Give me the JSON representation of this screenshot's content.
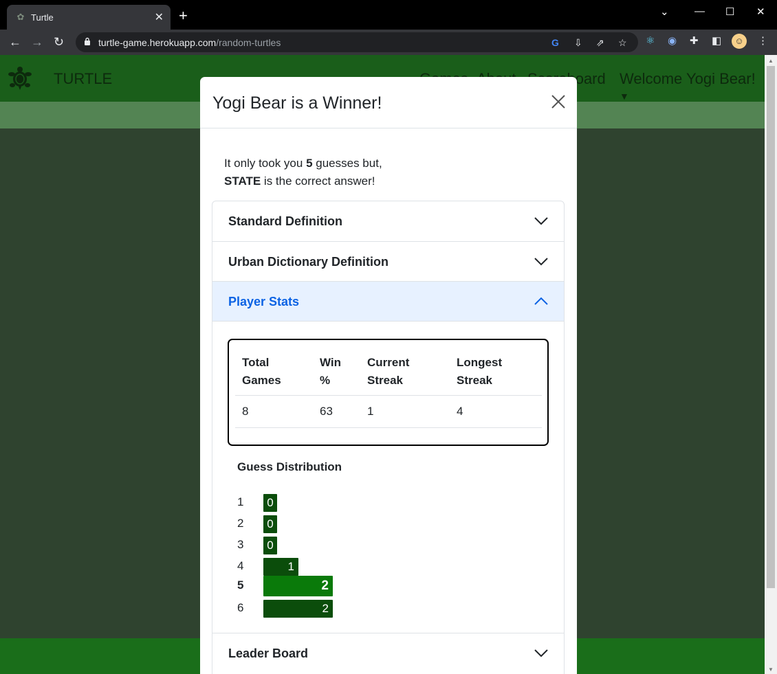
{
  "browser": {
    "tab_title": "Turtle",
    "url_host": "turtle-game.herokuapp.com",
    "url_path": "/random-turtles"
  },
  "navbar": {
    "brand": "TURTLE",
    "links": [
      "Games",
      "About",
      "Scoreboard"
    ],
    "user_menu": "Welcome Yogi Bear!"
  },
  "modal": {
    "title": "Yogi Bear is a Winner!",
    "message": {
      "line1_prefix": "It only took you ",
      "guess_count": "5",
      "line1_suffix": " guesses but,",
      "answer": "STATE",
      "line2_suffix": " is the correct answer!"
    },
    "accordion": {
      "standard_definition": "Standard Definition",
      "urban_definition": "Urban Dictionary Definition",
      "player_stats": "Player Stats",
      "leader_board": "Leader Board"
    },
    "stats": {
      "headers": [
        "Total Games",
        "Win %",
        "Current Streak",
        "Longest Streak"
      ],
      "values": [
        "8",
        "63",
        "1",
        "4"
      ]
    },
    "distribution": {
      "title": "Guess Distribution",
      "rows": [
        {
          "guess": "1",
          "count": 0
        },
        {
          "guess": "2",
          "count": 0
        },
        {
          "guess": "3",
          "count": 0
        },
        {
          "guess": "4",
          "count": 1
        },
        {
          "guess": "5",
          "count": 2
        },
        {
          "guess": "6",
          "count": 2
        }
      ],
      "current_guess": "5"
    }
  },
  "colors": {
    "navbar": "#1a5e1a",
    "subbar": "#538453",
    "page_bg": "#2f432f",
    "bar": "#0b4d0b",
    "bar_current": "#0a7a0a",
    "accordion_open_text": "#0c63e4"
  },
  "icons": {
    "logo": "turtle-icon",
    "close": "close-icon",
    "expand": "chevron-down-icon",
    "collapse": "chevron-up-icon"
  }
}
